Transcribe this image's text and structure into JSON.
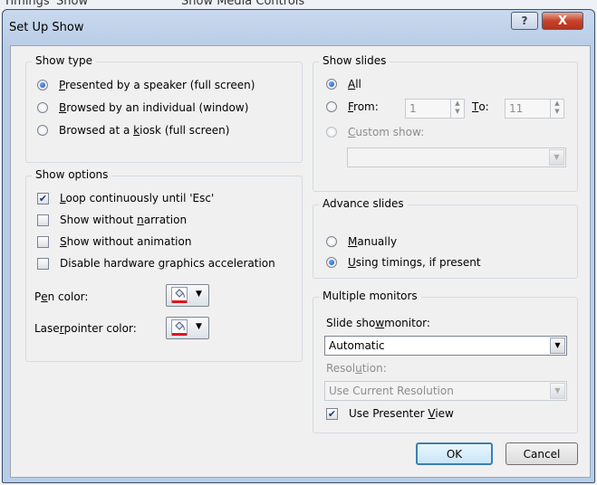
{
  "background": {
    "tab1": "Timings",
    "tab2": "Show",
    "tab3": "Show Media Controls"
  },
  "window": {
    "title": "Set Up Show",
    "help_label": "?",
    "close_label": "X"
  },
  "show_type": {
    "title": "Show type",
    "options": [
      {
        "pre": "",
        "u": "P",
        "post": "resented by a speaker (full screen)",
        "selected": true
      },
      {
        "pre": "",
        "u": "B",
        "post": "rowsed by an individual (window)",
        "selected": false
      },
      {
        "pre": "Browsed at a ",
        "u": "k",
        "post": "iosk (full screen)",
        "selected": false
      }
    ]
  },
  "show_options": {
    "title": "Show options",
    "checks": [
      {
        "pre": "",
        "u": "L",
        "post": "oop continuously until 'Esc'",
        "checked": true
      },
      {
        "pre": "Show without ",
        "u": "n",
        "post": "arration",
        "checked": false
      },
      {
        "pre": "",
        "u": "S",
        "post": "how without animation",
        "checked": false
      },
      {
        "pre": "Disable hardware ",
        "u": "g",
        "post": "raphics acceleration",
        "checked": false
      }
    ],
    "pen_color": {
      "pre": "P",
      "u": "e",
      "post": "n color:"
    },
    "laser_color": {
      "pre": "Lase",
      "u": "r",
      "post": " pointer color:"
    },
    "color_swatch": "#e0141c"
  },
  "show_slides": {
    "title": "Show slides",
    "all": {
      "u": "A",
      "post": "ll",
      "selected": true
    },
    "from": {
      "u": "F",
      "post": "rom:",
      "value": "1",
      "selected": false
    },
    "to": {
      "u": "T",
      "post": "o:",
      "value": "11"
    },
    "custom": {
      "u": "C",
      "post": "ustom show:",
      "value": ""
    }
  },
  "advance_slides": {
    "title": "Advance slides",
    "manually": {
      "u": "M",
      "post": "anually",
      "selected": false
    },
    "timings": {
      "u": "U",
      "post": "sing timings, if present",
      "selected": true
    }
  },
  "monitors": {
    "title": "Multiple monitors",
    "monitor_label": {
      "pre": "Slide sho",
      "u": "w",
      "post": " monitor:"
    },
    "monitor_value": "Automatic",
    "resolution_label": {
      "pre": "Resol",
      "u": "u",
      "post": "tion:"
    },
    "resolution_value": "Use Current Resolution",
    "presenter_view": {
      "pre": "Use Presenter ",
      "u": "V",
      "post": "iew",
      "checked": true
    }
  },
  "buttons": {
    "ok": "OK",
    "cancel": "Cancel"
  }
}
